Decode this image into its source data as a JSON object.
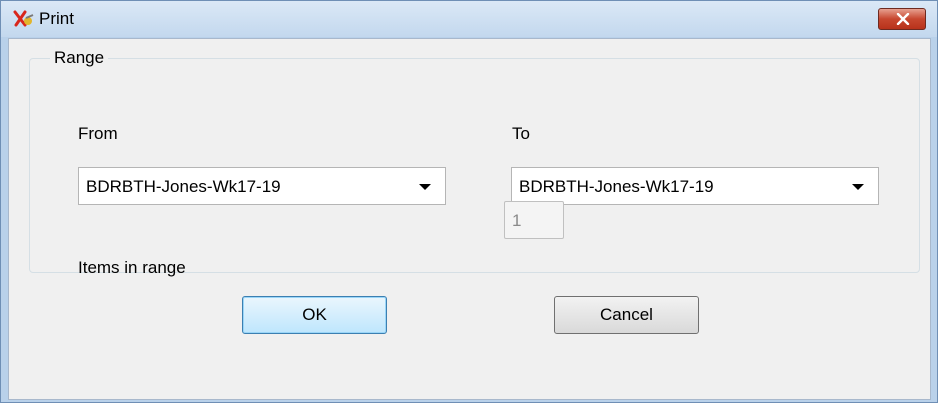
{
  "window": {
    "title": "Print",
    "app_icon": "tool-icon",
    "close_icon": "close-icon"
  },
  "range": {
    "group_label": "Range",
    "from_label": "From",
    "from_value": "BDRBTH-Jones-Wk17-19",
    "to_label": "To",
    "to_value": "BDRBTH-Jones-Wk17-19",
    "items_label": "Items in range",
    "items_value": "1"
  },
  "buttons": {
    "ok": "OK",
    "cancel": "Cancel"
  },
  "colors": {
    "titlebar": "#c3d8ee",
    "close_button": "#c7472f",
    "ok_focus": "#3c7fb1"
  }
}
